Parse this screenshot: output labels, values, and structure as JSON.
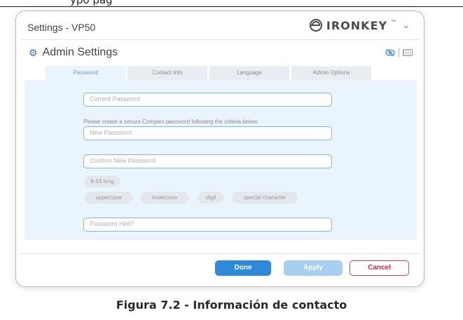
{
  "doc": {
    "top_text": "ypo                                                                          pag",
    "caption": "Figura 7.2 - Información de contacto"
  },
  "window": {
    "title": "Settings - VP50",
    "brand": "IRONKEY",
    "brand_tm": "™",
    "brand_chevron": "⌄"
  },
  "admin": {
    "title": "Admin Settings",
    "icon": "gear-icon"
  },
  "tabs": [
    {
      "label": "Password",
      "active": true
    },
    {
      "label": "Contact Info",
      "active": false
    },
    {
      "label": "Language",
      "active": false
    },
    {
      "label": "Admin Options",
      "active": false
    }
  ],
  "form": {
    "current_password_placeholder": "Current Password",
    "criteria_text": "Please create a secure Complex password following the criteria below.",
    "new_password_placeholder": "New Password",
    "confirm_password_placeholder": "Confirm New Password",
    "hint_placeholder": "Password Hint?",
    "criteria": [
      "6-16 long",
      "uppercase",
      "lowercase",
      "digit",
      "special character"
    ]
  },
  "buttons": {
    "done": "Done",
    "apply": "Apply",
    "cancel": "Cancel"
  },
  "colors": {
    "accent": "#2e8ad8",
    "cancel": "#e23a5a",
    "panel": "#eaf4fc"
  }
}
